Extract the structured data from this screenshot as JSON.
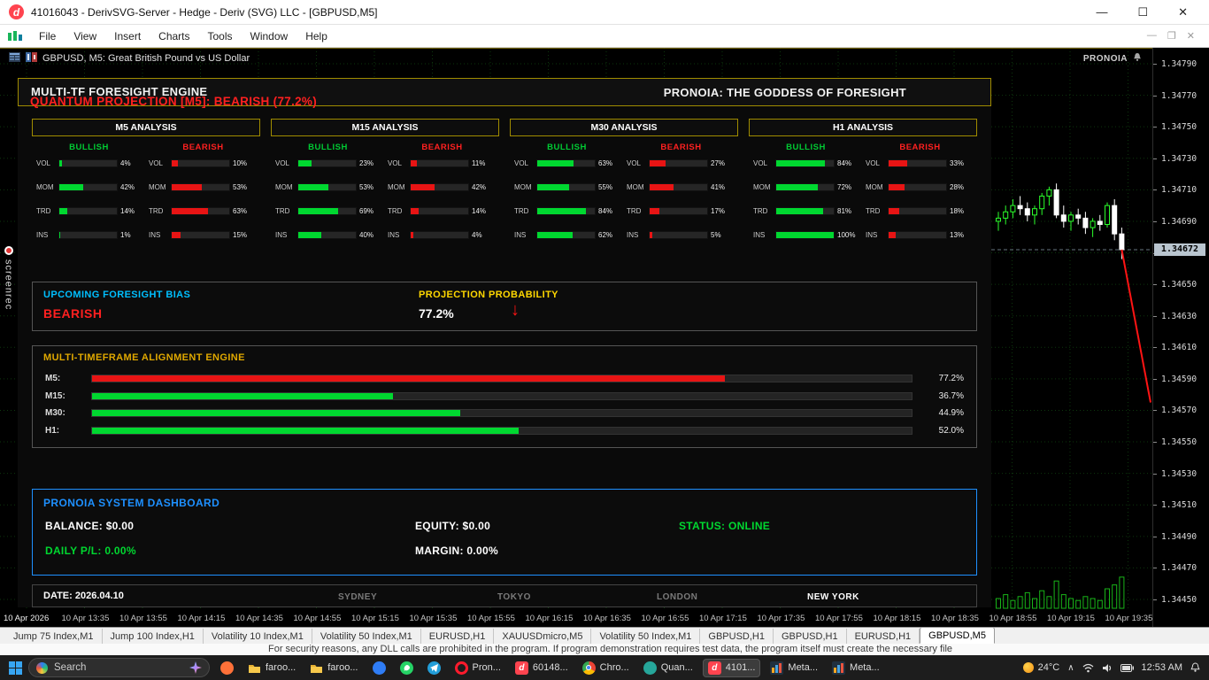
{
  "titlebar": {
    "logo_letter": "d",
    "title": "41016043 - DerivSVG-Server - Hedge - Deriv (SVG) LLC - [GBPUSD,M5]",
    "controls": {
      "minimize": "—",
      "maximize": "☐",
      "close": "✕"
    }
  },
  "menubar": {
    "items": [
      "File",
      "View",
      "Insert",
      "Charts",
      "Tools",
      "Window",
      "Help"
    ],
    "win_controls": [
      "—",
      "❐",
      "✕"
    ]
  },
  "chart": {
    "symbol_label": "GBPUSD, M5:  Great British Pound vs US Dollar",
    "watermark": "PRONOIA",
    "current_price": "1.34672",
    "price_ticks": [
      "1.34790",
      "1.34770",
      "1.34750",
      "1.34730",
      "1.34710",
      "1.34690",
      "1.34670",
      "1.34650",
      "1.34630",
      "1.34610",
      "1.34590",
      "1.34570",
      "1.34550",
      "1.34530",
      "1.34510",
      "1.34490",
      "1.34470",
      "1.34450"
    ],
    "time_ticks": [
      "10 Apr 2026",
      "10 Apr 13:35",
      "10 Apr 13:55",
      "10 Apr 14:15",
      "10 Apr 14:35",
      "10 Apr 14:55",
      "10 Apr 15:15",
      "10 Apr 15:35",
      "10 Apr 15:55",
      "10 Apr 16:15",
      "10 Apr 16:35",
      "10 Apr 16:55",
      "10 Apr 17:15",
      "10 Apr 17:35",
      "10 Apr 17:55",
      "10 Apr 18:15",
      "10 Apr 18:35",
      "10 Apr 18:55",
      "10 Apr 19:15",
      "10 Apr 19:35"
    ],
    "candles": [
      {
        "o": 1.3469,
        "h": 1.34696,
        "l": 1.34684,
        "c": 1.34692
      },
      {
        "o": 1.34692,
        "h": 1.347,
        "l": 1.34688,
        "c": 1.34696
      },
      {
        "o": 1.34696,
        "h": 1.34704,
        "l": 1.34692,
        "c": 1.347
      },
      {
        "o": 1.347,
        "h": 1.34706,
        "l": 1.34694,
        "c": 1.34698
      },
      {
        "o": 1.34698,
        "h": 1.34702,
        "l": 1.3469,
        "c": 1.34694
      },
      {
        "o": 1.34694,
        "h": 1.347,
        "l": 1.34688,
        "c": 1.34698
      },
      {
        "o": 1.34698,
        "h": 1.34708,
        "l": 1.34694,
        "c": 1.34706
      },
      {
        "o": 1.34706,
        "h": 1.34712,
        "l": 1.347,
        "c": 1.3471
      },
      {
        "o": 1.3471,
        "h": 1.34714,
        "l": 1.34692,
        "c": 1.34694
      },
      {
        "o": 1.34694,
        "h": 1.347,
        "l": 1.34686,
        "c": 1.3469
      },
      {
        "o": 1.3469,
        "h": 1.34696,
        "l": 1.34684,
        "c": 1.34694
      },
      {
        "o": 1.34694,
        "h": 1.34698,
        "l": 1.34688,
        "c": 1.34692
      },
      {
        "o": 1.34692,
        "h": 1.34696,
        "l": 1.34682,
        "c": 1.34686
      },
      {
        "o": 1.34686,
        "h": 1.34692,
        "l": 1.3468,
        "c": 1.3469
      },
      {
        "o": 1.3469,
        "h": 1.34694,
        "l": 1.34684,
        "c": 1.34688
      },
      {
        "o": 1.34688,
        "h": 1.34702,
        "l": 1.34686,
        "c": 1.347
      },
      {
        "o": 1.347,
        "h": 1.34704,
        "l": 1.34678,
        "c": 1.34682
      },
      {
        "o": 1.34682,
        "h": 1.34686,
        "l": 1.34666,
        "c": 1.34672
      }
    ],
    "volumes": [
      5,
      7,
      4,
      6,
      8,
      5,
      9,
      6,
      14,
      7,
      5,
      4,
      6,
      5,
      4,
      10,
      12,
      16
    ],
    "projection_line": {
      "from_price": 1.34672,
      "to_price": 1.34575
    }
  },
  "foresight": {
    "header_title": "MULTI-TF FORESIGHT ENGINE",
    "header_right": "PRONOIA: THE GODDESS OF FORESIGHT",
    "projection_line": "QUANTUM PROJECTION [M5]: BEARISH (77.2%)",
    "bull_header": "BULLISH",
    "bear_header": "BEARISH",
    "analyses": [
      {
        "title": "M5 ANALYSIS",
        "rows": [
          {
            "label": "VOL",
            "bull": 4,
            "bear": 10
          },
          {
            "label": "MOM",
            "bull": 42,
            "bear": 53
          },
          {
            "label": "TRD",
            "bull": 14,
            "bear": 63
          },
          {
            "label": "INS",
            "bull": 1,
            "bear": 15
          }
        ]
      },
      {
        "title": "M15 ANALYSIS",
        "rows": [
          {
            "label": "VOL",
            "bull": 23,
            "bear": 11
          },
          {
            "label": "MOM",
            "bull": 53,
            "bear": 42
          },
          {
            "label": "TRD",
            "bull": 69,
            "bear": 14
          },
          {
            "label": "INS",
            "bull": 40,
            "bear": 4
          }
        ]
      },
      {
        "title": "M30 ANALYSIS",
        "rows": [
          {
            "label": "VOL",
            "bull": 63,
            "bear": 27
          },
          {
            "label": "MOM",
            "bull": 55,
            "bear": 41
          },
          {
            "label": "TRD",
            "bull": 84,
            "bear": 17
          },
          {
            "label": "INS",
            "bull": 62,
            "bear": 5
          }
        ]
      },
      {
        "title": "H1 ANALYSIS",
        "rows": [
          {
            "label": "VOL",
            "bull": 84,
            "bear": 33
          },
          {
            "label": "MOM",
            "bull": 72,
            "bear": 28
          },
          {
            "label": "TRD",
            "bull": 81,
            "bear": 18
          },
          {
            "label": "INS",
            "bull": 100,
            "bear": 13
          }
        ]
      }
    ],
    "bias": {
      "label": "UPCOMING FORESIGHT BIAS",
      "value": "BEARISH",
      "prob_label": "PROJECTION PROBABILITY",
      "prob_value": "77.2%",
      "arrow": "↓"
    },
    "alignment": {
      "title": "MULTI-TIMEFRAME ALIGNMENT ENGINE",
      "rows": [
        {
          "label": "M5:",
          "pct": "77.2%",
          "value": 77.2,
          "color": "#e81414"
        },
        {
          "label": "M15:",
          "pct": "36.7%",
          "value": 36.7,
          "color": "#00d830"
        },
        {
          "label": "M30:",
          "pct": "44.9%",
          "value": 44.9,
          "color": "#00d830"
        },
        {
          "label": "H1:",
          "pct": "52.0%",
          "value": 52.0,
          "color": "#00d830"
        }
      ]
    },
    "dashboard": {
      "title": "PRONOIA SYSTEM DASHBOARD",
      "balance": "BALANCE: $0.00",
      "equity": "EQUITY: $0.00",
      "status": "STATUS: ONLINE",
      "daily_pl": "DAILY P/L: 0.00%",
      "margin": "MARGIN: 0.00%"
    },
    "footer": {
      "date": "DATE: 2026.04.10",
      "sessions": [
        "SYDNEY",
        "TOKYO",
        "LONDON",
        "NEW YORK"
      ],
      "active_session": "NEW YORK"
    }
  },
  "tabs": {
    "items": [
      "Jump 75 Index,M1",
      "Jump 100 Index,H1",
      "Volatility 10 Index,M1",
      "Volatility 50 Index,M1",
      "EURUSD,H1",
      "XAUUSDmicro,M5",
      "Volatility 50 Index,M1",
      "GBPUSD,H1",
      "GBPUSD,H1",
      "EURUSD,H1",
      "GBPUSD,M5"
    ],
    "active": "GBPUSD,M5"
  },
  "notice": {
    "text": "For security reasons, any DLL calls are prohibited in the program. If program demonstration requires test data, the program itself must create the necessary file"
  },
  "watermark": {
    "text": "screenrec"
  },
  "taskbar": {
    "search_placeholder": "Search",
    "items": [
      {
        "icon": "firefox",
        "label": "",
        "color": "#ff7139"
      },
      {
        "icon": "folder",
        "label": "faroo...",
        "color": "#f7c84b"
      },
      {
        "icon": "folder",
        "label": "faroo...",
        "color": "#f7c84b"
      },
      {
        "icon": "edge",
        "label": "",
        "color": "#2f7df6"
      },
      {
        "icon": "whatsapp",
        "label": "",
        "color": "#25d366"
      },
      {
        "icon": "telegram",
        "label": "",
        "color": "#229ed9"
      },
      {
        "icon": "opera",
        "label": "Pron...",
        "color": "#ff1b2d"
      },
      {
        "icon": "deriv",
        "label": "60148...",
        "color": "#ff444f"
      },
      {
        "icon": "chrome",
        "label": "Chro...",
        "color": "#4285f4"
      },
      {
        "icon": "app",
        "label": "Quan...",
        "color": "#26a69a"
      },
      {
        "icon": "deriv",
        "label": "4101...",
        "color": "#ff444f",
        "active": true
      },
      {
        "icon": "mt5",
        "label": "Meta...",
        "color": "#f5a623"
      },
      {
        "icon": "mt5",
        "label": "Meta...",
        "color": "#f5a623"
      }
    ],
    "tray": {
      "temp": "24°C",
      "time": "12:53 AM"
    }
  }
}
